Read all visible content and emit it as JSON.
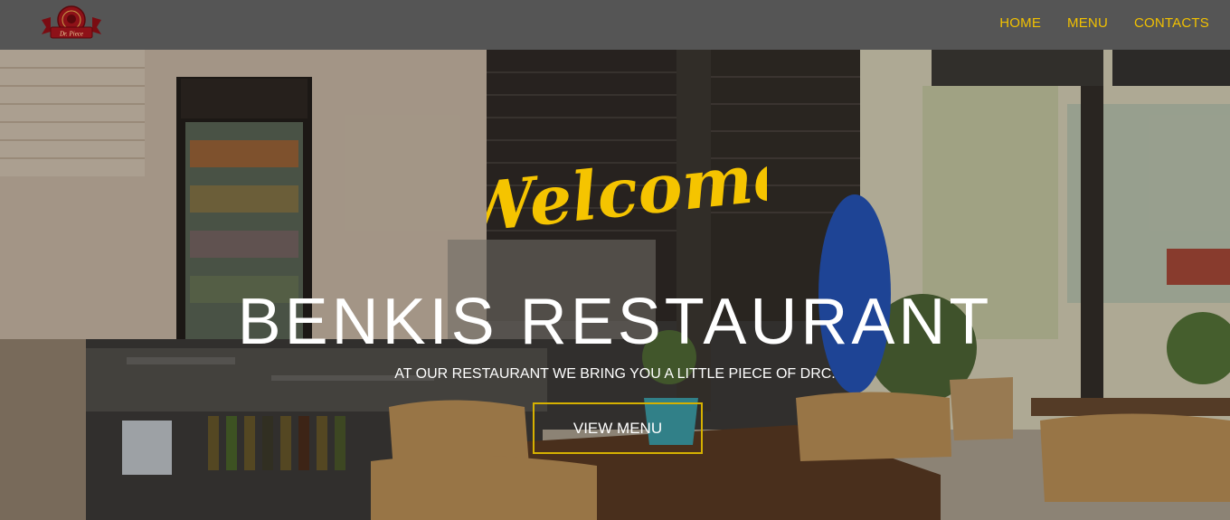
{
  "site": {
    "logo_text": "Dr. Piece"
  },
  "nav": {
    "items": [
      {
        "label": "HOME"
      },
      {
        "label": "MENU"
      },
      {
        "label": "CONTACTS"
      }
    ]
  },
  "hero": {
    "welcome": "Welcome",
    "title": "BENKIS RESTAURANT",
    "subtitle": "AT OUR RESTAURANT WE BRING YOU A LITTLE PIECE OF DRC.",
    "cta_label": "VIEW MENU",
    "background_description_icon": "restaurant-interior-photo"
  },
  "colors": {
    "nav_background": "#555555",
    "accent": "#f2c100",
    "cta_border": "#d6b100",
    "logo_red": "#8e1118"
  }
}
